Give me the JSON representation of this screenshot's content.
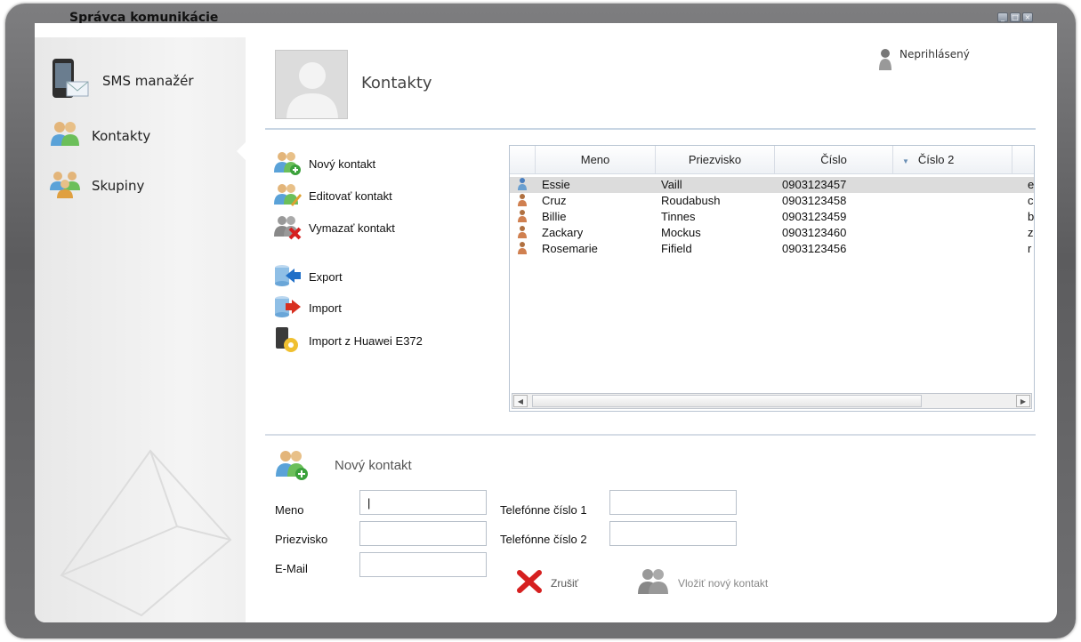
{
  "window": {
    "title": "Správca komunikácie",
    "controls": [
      "minimize",
      "maximize",
      "close"
    ]
  },
  "sidebar": {
    "items": [
      {
        "label": "SMS manažér",
        "icon": "phone-mail-icon"
      },
      {
        "label": "Kontakty",
        "icon": "contacts-icon",
        "active": true
      },
      {
        "label": "Skupiny",
        "icon": "groups-icon"
      }
    ]
  },
  "header": {
    "title": "Kontakty",
    "login_status": "Neprihlásený"
  },
  "actions": [
    {
      "label": "Nový kontakt",
      "icon": "add-contact-icon"
    },
    {
      "label": "Editovať kontakt",
      "icon": "edit-contact-icon"
    },
    {
      "label": "Vymazať kontakt",
      "icon": "delete-contact-icon"
    },
    {
      "label": "Export",
      "icon": "export-icon"
    },
    {
      "label": "Import",
      "icon": "import-icon"
    },
    {
      "label": "Import z Huawei E372",
      "icon": "import-huawei-icon"
    }
  ],
  "grid": {
    "columns": [
      "Meno",
      "Priezvisko",
      "Číslo",
      "Číslo 2"
    ],
    "sort_column": "Číslo 2",
    "rows": [
      {
        "meno": "Essie",
        "priezvisko": "Vaill",
        "cislo": "0903123457",
        "cislo2": "",
        "extra": "e",
        "selected": true
      },
      {
        "meno": "Cruz",
        "priezvisko": "Roudabush",
        "cislo": "0903123458",
        "cislo2": "",
        "extra": "c"
      },
      {
        "meno": "Billie",
        "priezvisko": "Tinnes",
        "cislo": "0903123459",
        "cislo2": "",
        "extra": "b"
      },
      {
        "meno": "Zackary",
        "priezvisko": "Mockus",
        "cislo": "0903123460",
        "cislo2": "",
        "extra": "z"
      },
      {
        "meno": "Rosemarie",
        "priezvisko": "Fifield",
        "cislo": "0903123456",
        "cislo2": "",
        "extra": "r"
      }
    ]
  },
  "form": {
    "title": "Nový kontakt",
    "labels": {
      "meno": "Meno",
      "priezvisko": "Priezvisko",
      "email": "E-Mail",
      "tel1": "Telefónne číslo 1",
      "tel2": "Telefónne číslo 2"
    },
    "values": {
      "meno": "|",
      "priezvisko": "",
      "email": "",
      "tel1": "",
      "tel2": ""
    },
    "cancel_label": "Zrušiť",
    "submit_label": "Vložiť nový kontakt"
  }
}
